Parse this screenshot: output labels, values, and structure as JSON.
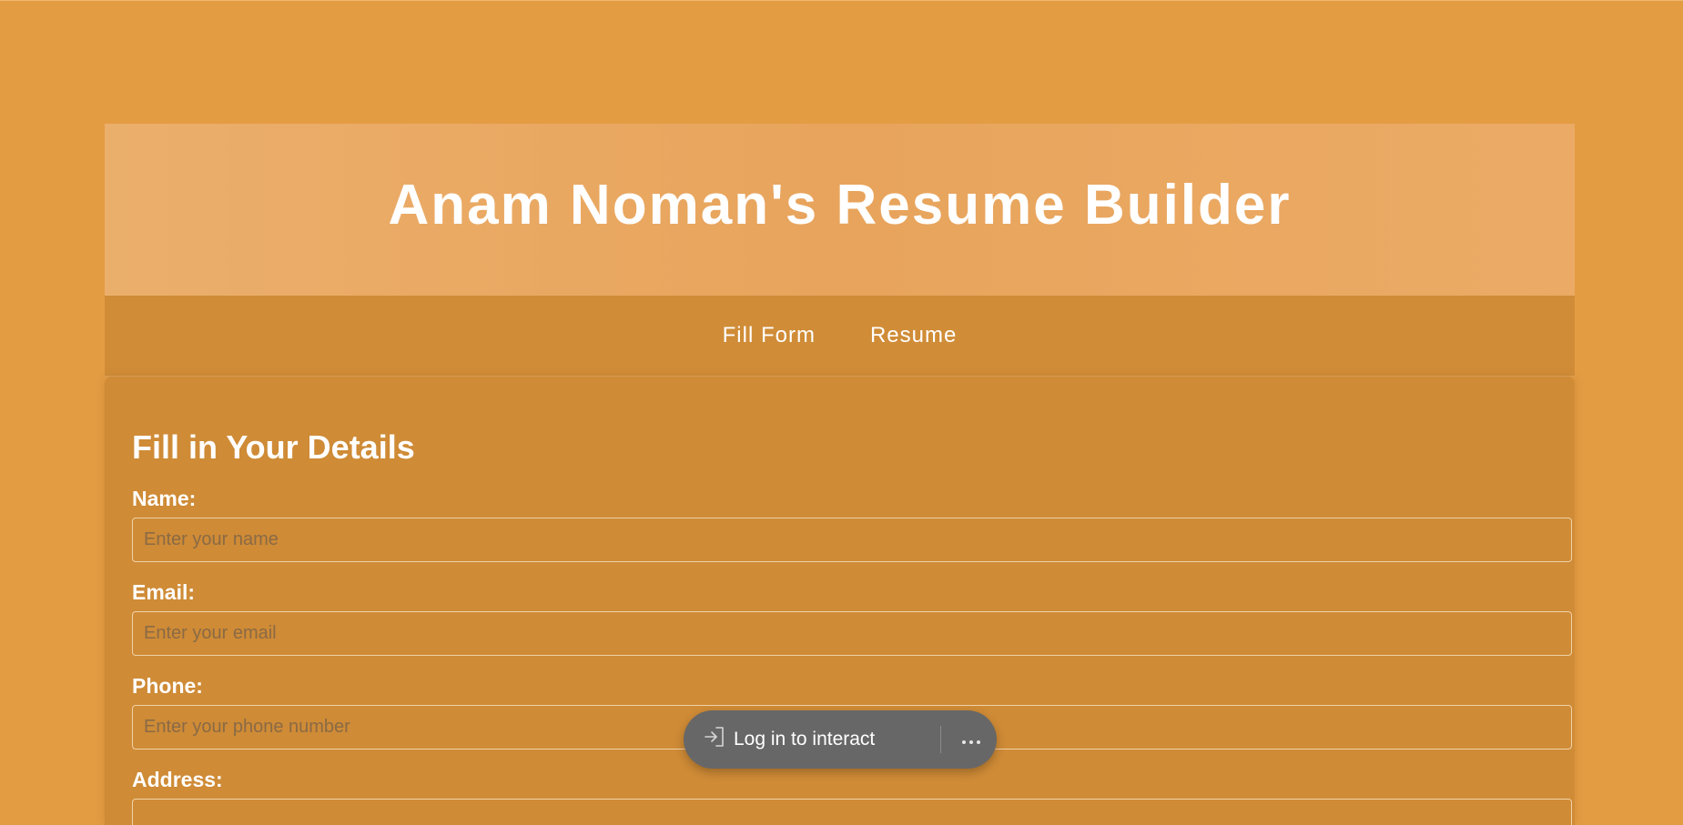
{
  "app": {
    "title": "Anam Noman's Resume Builder"
  },
  "nav": {
    "items": [
      {
        "label": "Fill Form"
      },
      {
        "label": "Resume"
      }
    ]
  },
  "form": {
    "heading": "Fill in Your Details",
    "fields": [
      {
        "label": "Name:",
        "placeholder": "Enter your name",
        "value": ""
      },
      {
        "label": "Email:",
        "placeholder": "Enter your email",
        "value": ""
      },
      {
        "label": "Phone:",
        "placeholder": "Enter your phone number",
        "value": ""
      },
      {
        "label": "Address:",
        "placeholder": "",
        "value": ""
      }
    ]
  },
  "overlay": {
    "login_label": "Log in to interact",
    "login_icon": "sign-in-icon",
    "more_icon": "more-options-icon"
  },
  "colors": {
    "background": "#e49c43",
    "header": "#eaab67",
    "nav": "#d08c37",
    "card": "#cf8b36",
    "overlay_pill": "#676767"
  }
}
